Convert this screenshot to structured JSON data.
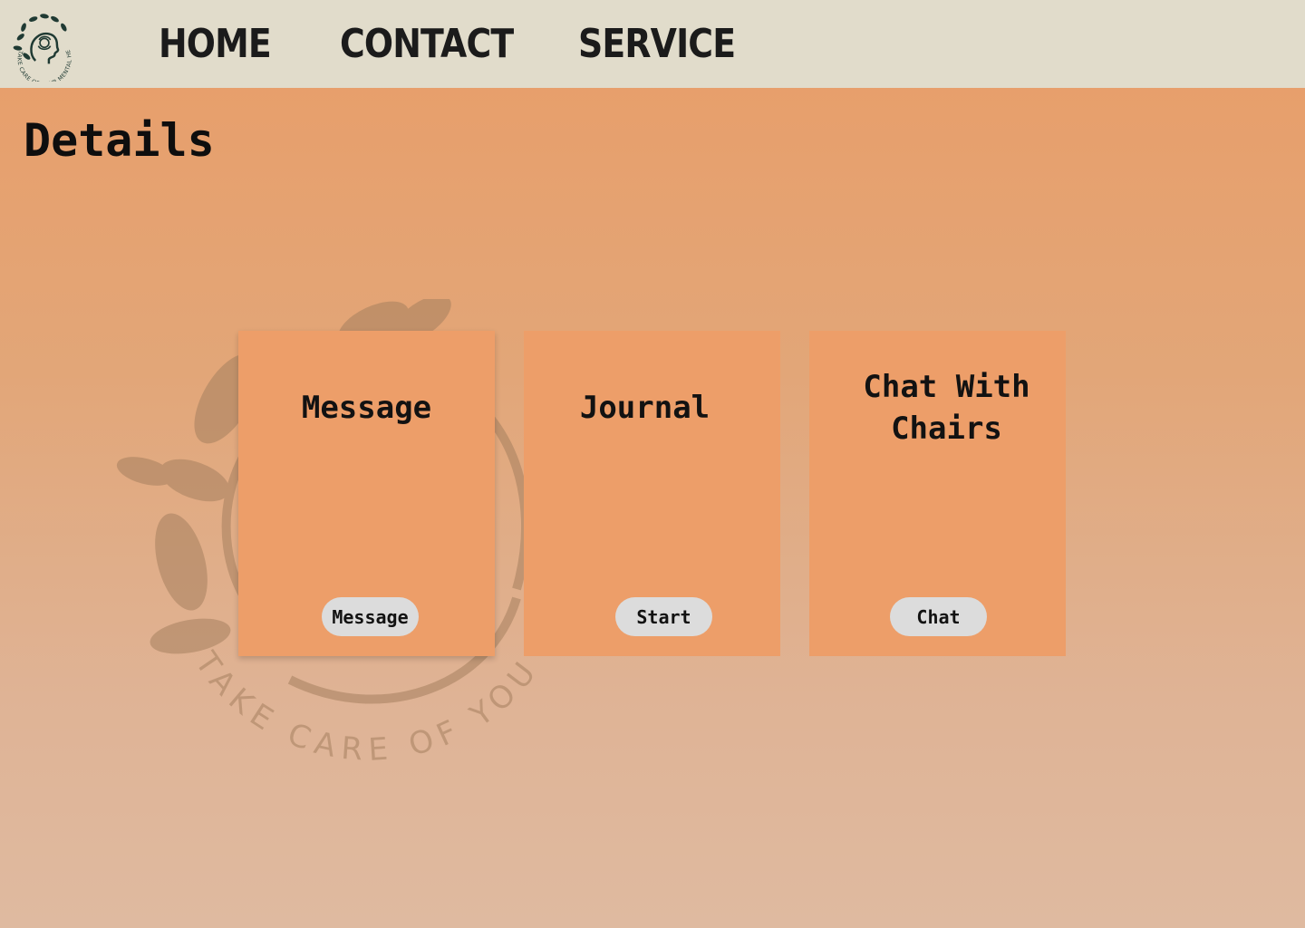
{
  "header": {
    "logo": {
      "icon": "mental-health-wreath-logo",
      "text": "TAKE CARE OF YOUR MENTAL HEALTH"
    },
    "nav": [
      {
        "label": "HOME"
      },
      {
        "label": "CONTACT"
      },
      {
        "label": "SERVICE"
      }
    ]
  },
  "page": {
    "title": "Details",
    "watermark_text": "TAKE CARE OF YOUR M"
  },
  "cards": [
    {
      "title": "Message",
      "button_label": "Message"
    },
    {
      "title": "Journal",
      "button_label": "Start"
    },
    {
      "title": "Chat With Chairs",
      "button_label": "Chat"
    }
  ],
  "colors": {
    "header_bg": "#e1dccb",
    "card_bg": "#ed9e69",
    "button_bg": "#dcdcdc",
    "text": "#121212"
  }
}
